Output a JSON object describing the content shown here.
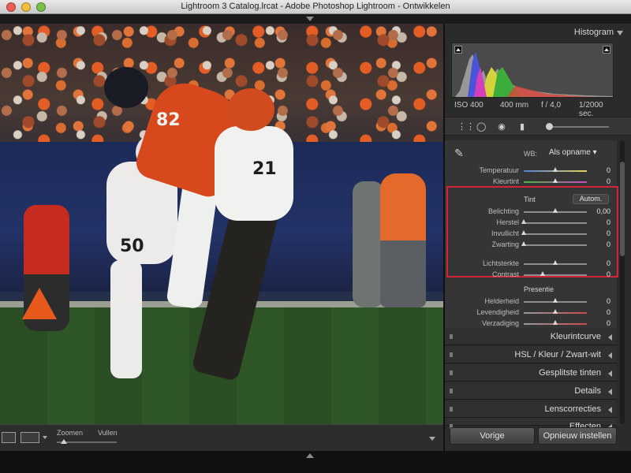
{
  "window": {
    "title": "Lightroom 3 Catalog.lrcat - Adobe Photoshop Lightroom - Ontwikkelen"
  },
  "photo": {
    "jersey_numbers": [
      "82",
      "21",
      "50"
    ]
  },
  "toolbar": {
    "zoom_label": "Zoomen",
    "fill_label": "Vullen",
    "zoom_value": 0.12
  },
  "histogram": {
    "title": "Histogram",
    "iso": "ISO 400",
    "focal": "400 mm",
    "aperture": "f / 4,0",
    "shutter": "1/2000 sec."
  },
  "basic": {
    "wb_label": "WB:",
    "wb_value": "Als opname ▾",
    "tone_label": "Tint",
    "auto_label": "Autom.",
    "presence_label": "Presentie",
    "rows": [
      {
        "label": "Temperatuur",
        "value": "0",
        "level": 0.5,
        "track": "temp"
      },
      {
        "label": "Kleurtint",
        "value": "0",
        "level": 0.5,
        "track": "tint"
      },
      {
        "label": "Belichting",
        "value": "0,00",
        "level": 0.5,
        "track": "gray"
      },
      {
        "label": "Herstel",
        "value": "0",
        "level": 0.0,
        "track": "gray"
      },
      {
        "label": "Invullicht",
        "value": "0",
        "level": 0.0,
        "track": "gray"
      },
      {
        "label": "Zwarting",
        "value": "0",
        "level": 0.0,
        "track": "gray"
      },
      {
        "label": "Lichtsterkte",
        "value": "0",
        "level": 0.5,
        "track": "gray"
      },
      {
        "label": "Contrast",
        "value": "0",
        "level": 0.3,
        "track": "gray"
      },
      {
        "label": "Helderheid",
        "value": "0",
        "level": 0.5,
        "track": "gray"
      },
      {
        "label": "Levendigheid",
        "value": "0",
        "level": 0.5,
        "track": "vib"
      },
      {
        "label": "Verzadiging",
        "value": "0",
        "level": 0.5,
        "track": "vib"
      }
    ]
  },
  "sections": [
    "Kleurintcurve",
    "HSL / Kleur / Zwart-wit",
    "Gesplitste tinten",
    "Details",
    "Lenscorrecties",
    "Effecten"
  ],
  "buttons": {
    "previous": "Vorige",
    "reset": "Opnieuw instellen"
  },
  "colors": {
    "highlight": "#d4243a",
    "panel": "#353535"
  },
  "icons": [
    "crop-icon",
    "spot-removal-icon",
    "red-eye-icon",
    "graduated-filter-icon",
    "adjustment-brush-icon",
    "eyedropper-icon"
  ]
}
